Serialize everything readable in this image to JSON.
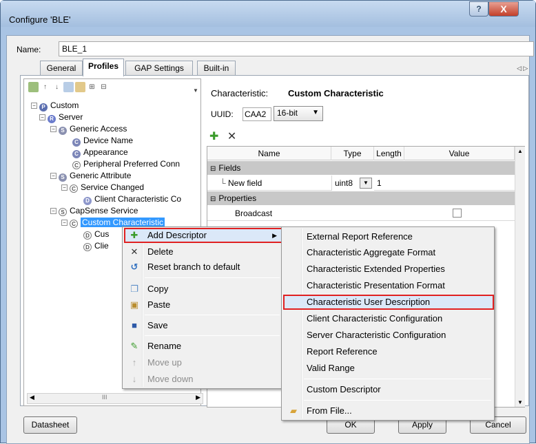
{
  "window": {
    "title": "Configure 'BLE'",
    "help": "?",
    "close": "X"
  },
  "name_field": {
    "label": "Name:",
    "value": "BLE_1"
  },
  "tabs": [
    {
      "label": "General"
    },
    {
      "label": "Profiles"
    },
    {
      "label": "GAP Settings"
    },
    {
      "label": "Built-in"
    }
  ],
  "tab_scroll": "◁ ▷",
  "tree": {
    "root": "Custom",
    "server": "Server",
    "generic_access": "Generic Access",
    "device_name": "Device Name",
    "appearance": "Appearance",
    "peripheral_pref": "Peripheral Preferred Conn",
    "generic_attribute": "Generic Attribute",
    "service_changed": "Service Changed",
    "client_char_conf": "Client Characteristic Co",
    "capsense": "CapSense Service",
    "custom_char": "Custom Characteristic",
    "cus": "Cus",
    "clie": "Clie",
    "hscroll_label": "III"
  },
  "characteristic": {
    "label": "Characteristic:",
    "name": "Custom Characteristic",
    "uuid_label": "UUID:",
    "uuid_value": "CAA2",
    "uuid_type": "16-bit"
  },
  "grid": {
    "headers": [
      "Name",
      "Type",
      "Length",
      "Value"
    ],
    "groups": {
      "fields": "Fields",
      "properties": "Properties"
    },
    "field_row": {
      "name": "New field",
      "type": "uint8",
      "length": "1"
    },
    "partial_row": "Broadcast"
  },
  "buttons": {
    "datasheet": "Datasheet",
    "ok": "OK",
    "apply": "Apply",
    "cancel": "Cancel"
  },
  "context_menu": {
    "items": [
      {
        "label": "Add Descriptor",
        "icon": "green-plus-icon",
        "glyph": "+"
      },
      {
        "label": "Delete",
        "icon": "delete-x-icon",
        "glyph": "✕"
      },
      {
        "label": "Reset branch to default",
        "icon": "reset-icon",
        "glyph": "↺"
      },
      {
        "label": "Copy",
        "icon": "copy-icon",
        "glyph": "❐"
      },
      {
        "label": "Paste",
        "icon": "paste-icon",
        "glyph": "📋"
      },
      {
        "label": "Save",
        "icon": "save-icon",
        "glyph": "💾"
      },
      {
        "label": "Rename",
        "icon": "rename-icon",
        "glyph": "✎"
      },
      {
        "label": "Move up",
        "icon": "arrow-up-icon",
        "glyph": "↑"
      },
      {
        "label": "Move down",
        "icon": "arrow-down-icon",
        "glyph": "↓"
      }
    ]
  },
  "submenu": {
    "items": [
      "External Report Reference",
      "Characteristic Aggregate Format",
      "Characteristic Extended Properties",
      "Characteristic Presentation Format",
      "Characteristic User Description",
      "Client Characteristic Configuration",
      "Server Characteristic Configuration",
      "Report Reference",
      "Valid Range",
      "Custom Descriptor",
      "From File..."
    ]
  }
}
